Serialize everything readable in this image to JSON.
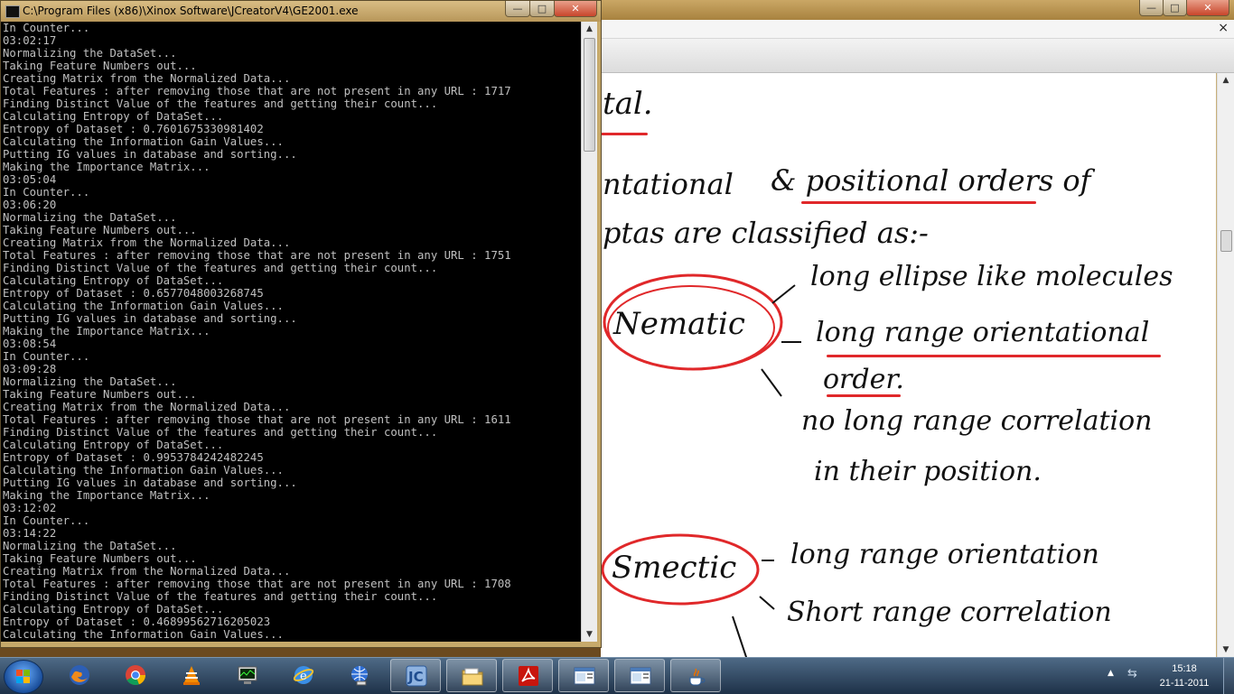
{
  "console": {
    "title": "C:\\Program Files (x86)\\Xinox Software\\JCreatorV4\\GE2001.exe",
    "minimize": "—",
    "maximize": "□",
    "close": "✕",
    "lines": [
      "In Counter...",
      "03:02:17",
      "Normalizing the DataSet...",
      "Taking Feature Numbers out...",
      "Creating Matrix from the Normalized Data...",
      "Total Features : after removing those that are not present in any URL : 1717",
      "Finding Distinct Value of the features and getting their count...",
      "Calculating Entropy of DataSet...",
      "Entropy of Dataset : 0.7601675330981402",
      "Calculating the Information Gain Values...",
      "Putting IG values in database and sorting...",
      "Making the Importance Matrix...",
      "03:05:04",
      "In Counter...",
      "03:06:20",
      "Normalizing the DataSet...",
      "Taking Feature Numbers out...",
      "Creating Matrix from the Normalized Data...",
      "Total Features : after removing those that are not present in any URL : 1751",
      "Finding Distinct Value of the features and getting their count...",
      "Calculating Entropy of DataSet...",
      "Entropy of Dataset : 0.6577048003268745",
      "Calculating the Information Gain Values...",
      "Putting IG values in database and sorting...",
      "Making the Importance Matrix...",
      "03:08:54",
      "In Counter...",
      "03:09:28",
      "Normalizing the DataSet...",
      "Taking Feature Numbers out...",
      "Creating Matrix from the Normalized Data...",
      "Total Features : after removing those that are not present in any URL : 1611",
      "Finding Distinct Value of the features and getting their count...",
      "Calculating Entropy of DataSet...",
      "Entropy of Dataset : 0.9953784242482245",
      "Calculating the Information Gain Values...",
      "Putting IG values in database and sorting...",
      "Making the Importance Matrix...",
      "03:12:02",
      "In Counter...",
      "03:14:22",
      "Normalizing the DataSet...",
      "Taking Feature Numbers out...",
      "Creating Matrix from the Normalized Data...",
      "Total Features : after removing those that are not present in any URL : 1708",
      "Finding Distinct Value of the features and getting their count...",
      "Calculating Entropy of DataSet...",
      "Entropy of Dataset : 0.46899562716205023",
      "Calculating the Information Gain Values..."
    ]
  },
  "document": {
    "close_x": "×",
    "notes": {
      "line1": "tal.",
      "line2a": "ntational",
      "line2b": "& positional orders of",
      "line3": "ptas are classified as:-",
      "nematic_label": "Nematic",
      "nematic_1": "long ellipse like molecules",
      "nematic_2a": "long range orientational",
      "nematic_2b": "order.",
      "nematic_3": "no long range correlation",
      "nematic_4": "in their position.",
      "smectic_label": "Smectic",
      "smectic_1": "long range orientation",
      "smectic_2": "Short range correlation"
    }
  },
  "taskbar": {
    "items": [
      "firefox-icon",
      "chrome-icon",
      "vlc-icon",
      "task-manager-icon",
      "ie-icon",
      "network-icon",
      "jcreator-icon",
      "explorer-icon",
      "pdf-reader-icon",
      "window-app-icon",
      "window-app-icon-2",
      "java-icon"
    ],
    "time": "15:18",
    "date": "21-11-2011",
    "colors": {
      "red_ink": "#e0282a"
    }
  }
}
